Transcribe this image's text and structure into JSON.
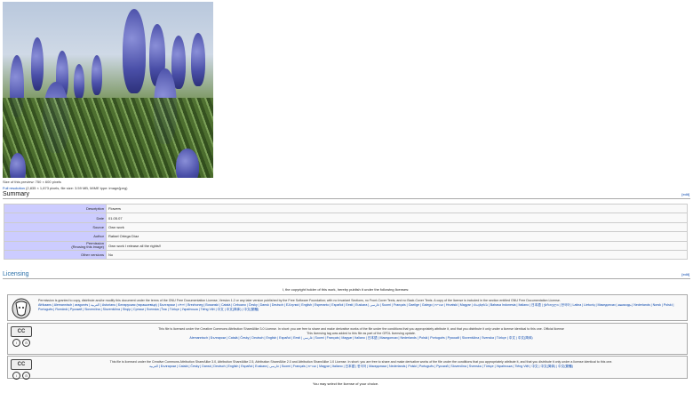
{
  "image": {
    "caption": "Size of this preview: 750 × 600 pixels",
    "full_resolution_label": "Full resolution",
    "file_info": "(2,835 × 1,873 pixels, file size: 3.59 MB, MIME type: image/jpeg)"
  },
  "summary": {
    "heading": "Summary",
    "edit": "[edit]",
    "rows": [
      {
        "label": "Description",
        "value": "Flowers"
      },
      {
        "label": "Date",
        "value": "01.05.07"
      },
      {
        "label": "Source",
        "value": "Own work"
      },
      {
        "label": "Author",
        "value": "Rafael Ortega Díaz"
      },
      {
        "label": "Permission\n(Reusing this image)",
        "value": "Own work I release all the rights!!"
      },
      {
        "label": "Other versions",
        "value": "No"
      }
    ]
  },
  "licensing": {
    "heading": "Licensing",
    "edit": "[edit]",
    "intro": "I, the copyright holder of this work, hereby publish it under the following licenses:",
    "gfdl_text": "Permission is granted to copy, distribute and/or modify this document under the terms of the GNU Free Documentation License, Version 1.2 or any later version published by the Free Software Foundation; with no Invariant Sections, no Front-Cover Texts, and no Back-Cover Texts. A copy of the license is included in the section entitled GNU Free Documentation License.",
    "gfdl_langs": "Afrikaans | Alemannisch | aragonés | العربية | Asturianu | Беларуская (тарашкевіца) | Български | বাংলা | Brezhoneg | Bosanski | Català | Cebuano | Česky | Dansk | Deutsch | Ελληνικά | English | Esperanto | Español | Eesti | Euskara | فارسی | Suomi | Français | Gaeilge | Galego | עברית | Hrvatski | Magyar | Հայերեն | Bahasa Indonesia | Italiano | 日本語 | ქართული | 한국어 | Latina | Lietuvių | Македонски | മലയാളം | Nederlands | Norsk | Polski | Português | Română | Русский | Slovenčina | Slovenščina | Shqip | Српски | Svenska | ไทย | Türkçe | Українська | Tiếng Việt | 中文 | 中文(简体) | 中文(繁體)",
    "cc30_text": "This file is licensed under the Creative Commons Attribution ShareAlike 3.0 License. In short: you are free to share and make derivative works of the file under the conditions that you appropriately attribute it, and that you distribute it only under a license identical to this one. Official license",
    "cc30_added": "This licensing tag was added to this file as part of the GFDL licensing update.",
    "cc30_langs": "Alemannisch | Български | Català | Česky | Deutsch | English | Español | Eesti | فارسی | Suomi | Français | Magyar | Italiano | 日本語 | Македонски | Nederlands | Polski | Português | Русский | Slovenščina | Svenska | Türkçe | 中文 | 中文(简体)",
    "cc_multi_text": "This file is licensed under the Creative Commons Attribution ShareAlike 3.0, Attribution ShareAlike 2.5, Attribution ShareAlike 2.0 and Attribution ShareAlike 1.0 License. In short: you are free to share and make derivative works of the file under the conditions that you appropriately attribute it, and that you distribute it only under a license identical to this one.",
    "cc_multi_langs": "العربية | Български | Català | Česky | Dansk | Deutsch | English | Español | Euskara | فارسی | Suomi | Français | עברית | Magyar | Italiano | 日本語 | 한국어 | Македонски | Nederlands | Polski | Português | Русский | Slovenčina | Svenska | Türkçe | Українська | Tiếng Việt | 中文 | 中文(简体) | 中文(繁體)",
    "choose": "You may select the license of your choice."
  }
}
